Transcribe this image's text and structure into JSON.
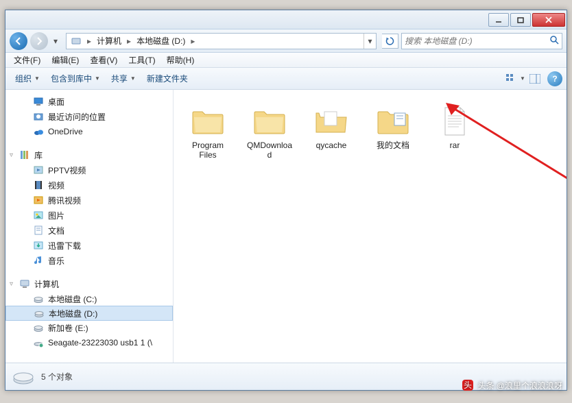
{
  "titlebar": {},
  "nav": {
    "breadcrumb": [
      "计算机",
      "本地磁盘 (D:)"
    ],
    "search_placeholder": "搜索 本地磁盘 (D:)"
  },
  "menubar": {
    "items": [
      "文件(F)",
      "编辑(E)",
      "查看(V)",
      "工具(T)",
      "帮助(H)"
    ]
  },
  "toolbar": {
    "organize": "组织",
    "include": "包含到库中",
    "share": "共享",
    "newfolder": "新建文件夹"
  },
  "sidebar": {
    "favorites": [
      {
        "label": "桌面",
        "icon": "desktop"
      },
      {
        "label": "最近访问的位置",
        "icon": "recent"
      },
      {
        "label": "OneDrive",
        "icon": "onedrive"
      }
    ],
    "libraries_label": "库",
    "libraries": [
      {
        "label": "PPTV视频",
        "icon": "video"
      },
      {
        "label": "视频",
        "icon": "film"
      },
      {
        "label": "腾讯视频",
        "icon": "tencent"
      },
      {
        "label": "图片",
        "icon": "pictures"
      },
      {
        "label": "文档",
        "icon": "docs"
      },
      {
        "label": "迅雷下载",
        "icon": "download"
      },
      {
        "label": "音乐",
        "icon": "music"
      }
    ],
    "computer_label": "计算机",
    "drives": [
      {
        "label": "本地磁盘 (C:)",
        "icon": "drive"
      },
      {
        "label": "本地磁盘 (D:)",
        "icon": "drive",
        "selected": true
      },
      {
        "label": "新加卷 (E:)",
        "icon": "drive"
      },
      {
        "label": "Seagate-23223030 usb1 1 (\\",
        "icon": "netdrive"
      }
    ]
  },
  "files": [
    {
      "label": "Program Files",
      "type": "folder"
    },
    {
      "label": "QMDownload",
      "type": "folder"
    },
    {
      "label": "qycache",
      "type": "folder-open"
    },
    {
      "label": "我的文档",
      "type": "folder-doc"
    },
    {
      "label": "rar",
      "type": "txt"
    }
  ],
  "statusbar": {
    "text": "5 个对象"
  },
  "watermark": "头条 @浪里个浪浪浪呀"
}
